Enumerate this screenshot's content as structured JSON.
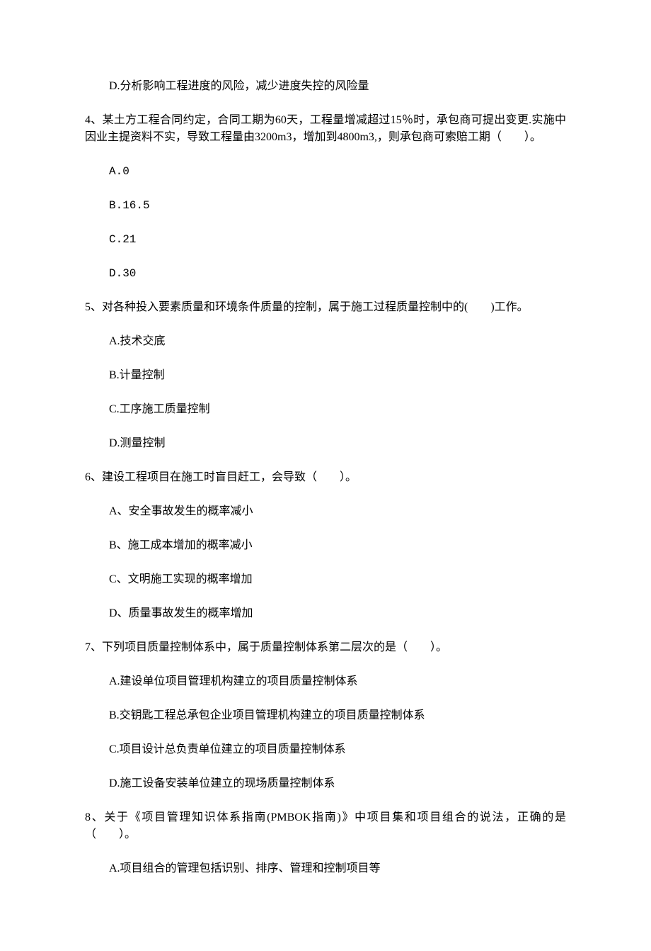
{
  "prev_option_d": "D.分析影响工程进度的风险，减少进度失控的风险量",
  "q4": {
    "stem": "4、某土方工程合同约定，合同工期为60天，工程量增减超过15％时，承包商可提出变更.实施中因业主提资料不实，导致工程量由3200m3，增加到4800m3,，则承包商可索赔工期（　　）。",
    "a": "A.0",
    "b": "B.16.5",
    "c": "C.21",
    "d": "D.30"
  },
  "q5": {
    "stem": "5、对各种投入要素质量和环境条件质量的控制，属于施工过程质量控制中的(　　)工作。",
    "a": "A.技术交底",
    "b": "B.计量控制",
    "c": "C.工序施工质量控制",
    "d": "D.测量控制"
  },
  "q6": {
    "stem": "6、建设工程项目在施工时盲目赶工，会导致（　　）。",
    "a": "A、安全事故发生的概率减小",
    "b": "B、施工成本增加的概率减小",
    "c": "C、文明施工实现的概率增加",
    "d": "D、质量事故发生的概率增加"
  },
  "q7": {
    "stem": "7、下列项目质量控制体系中，属于质量控制体系第二层次的是（　　）。",
    "a": "A.建设单位项目管理机构建立的项目质量控制体系",
    "b": "B.交钥匙工程总承包企业项目管理机构建立的项目质量控制体系",
    "c": "C.项目设计总负责单位建立的项目质量控制体系",
    "d": "D.施工设备安装单位建立的现场质量控制体系"
  },
  "q8": {
    "stem": "8、关于《项目管理知识体系指南(PMBOK指南)》中项目集和项目组合的说法，正确的是（　　）。",
    "a": "A.项目组合的管理包括识别、排序、管理和控制项目等"
  }
}
